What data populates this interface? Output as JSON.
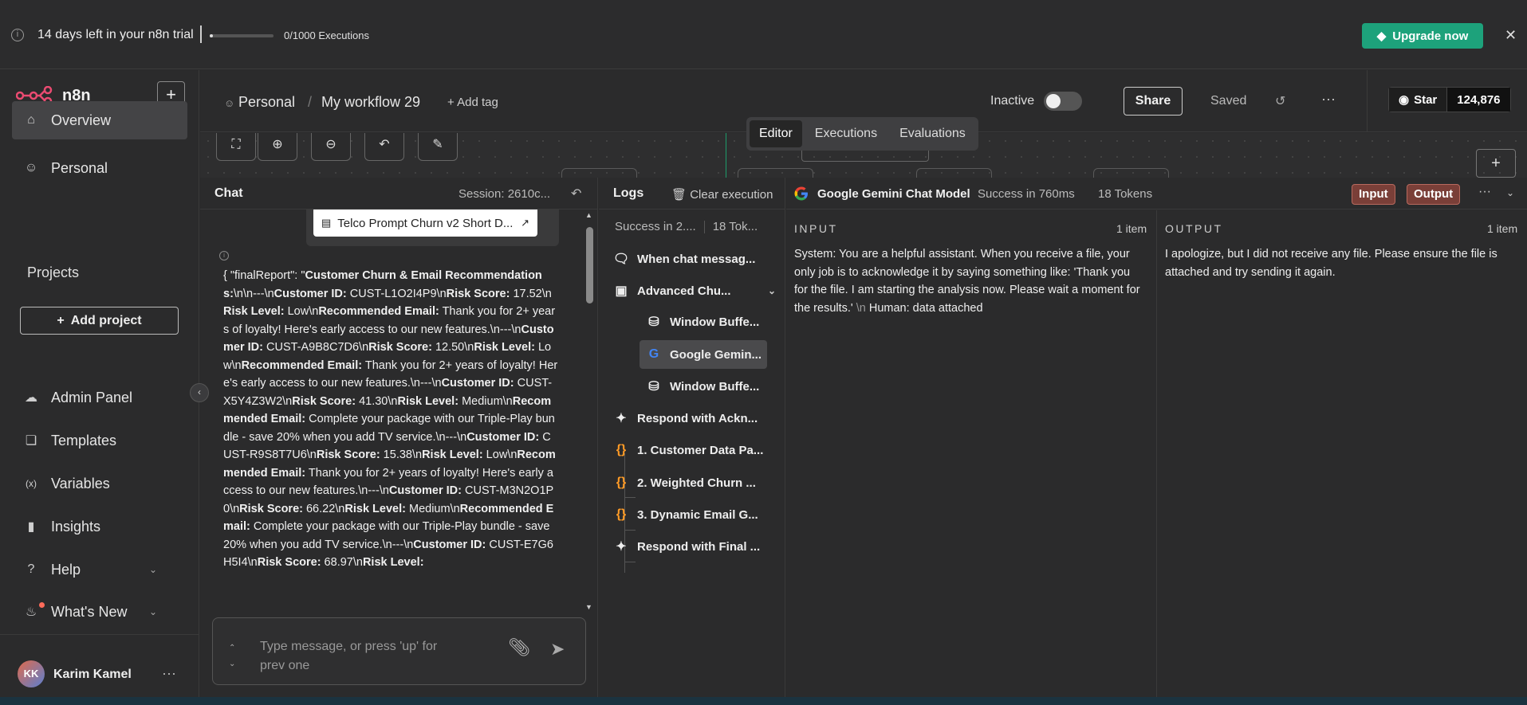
{
  "banner": {
    "trial_text": "14 days left in your n8n trial",
    "executions": "0/1000 Executions",
    "executions_used_fraction": 0.0,
    "upgrade_label": "Upgrade now",
    "upgrade_color": "#1da27b"
  },
  "sidebar": {
    "brand": "n8n",
    "items": [
      {
        "label": "Overview",
        "icon": "home-icon"
      },
      {
        "label": "Personal",
        "icon": "user-icon"
      }
    ],
    "projects_title": "Projects",
    "add_project": "Add project",
    "bottom_items": [
      {
        "label": "Admin Panel",
        "icon": "cloud-icon"
      },
      {
        "label": "Templates",
        "icon": "box-icon"
      },
      {
        "label": "Variables",
        "icon": "variable-icon"
      },
      {
        "label": "Insights",
        "icon": "chart-icon"
      },
      {
        "label": "Help",
        "icon": "help-icon"
      },
      {
        "label": "What's New",
        "icon": "bell-icon"
      }
    ],
    "user": {
      "initials": "KK",
      "name": "Karim Kamel"
    }
  },
  "header": {
    "project": "Personal",
    "workflow": "My workflow 29",
    "add_tag": "+ Add tag",
    "status": "Inactive",
    "share": "Share",
    "saved": "Saved",
    "github_star": "Star",
    "github_count": "124,876"
  },
  "canvas": {
    "tabs": [
      "Editor",
      "Executions",
      "Evaluations"
    ],
    "active_tab": "Editor"
  },
  "chat": {
    "title": "Chat",
    "session": "Session: 2610c...",
    "file_name": "Telco Prompt Churn v2 Short D...",
    "input_placeholder": "Type message, or press 'up' for prev one"
  },
  "logs": {
    "title": "Logs",
    "clear": "Clear execution",
    "summary_status": "Success in 2....",
    "summary_tokens": "18 Tok...",
    "items": [
      {
        "label": "When chat messag...",
        "icon": "chat-icon",
        "level": 0
      },
      {
        "label": "Advanced Chu...",
        "icon": "robot-icon",
        "level": 0
      },
      {
        "label": "Window Buffe...",
        "icon": "database-icon",
        "level": 1
      },
      {
        "label": "Google Gemin...",
        "icon": "google-icon",
        "level": 1
      },
      {
        "label": "Window Buffe...",
        "icon": "database-icon",
        "level": 1
      },
      {
        "label": "Respond with Ackn...",
        "icon": "webhook-icon",
        "level": 0
      },
      {
        "label": "1. Customer Data Pa...",
        "icon": "code-braces-icon",
        "level": 0
      },
      {
        "label": "2. Weighted Churn ...",
        "icon": "code-braces-icon",
        "level": 0
      },
      {
        "label": "3. Dynamic Email G...",
        "icon": "code-braces-icon",
        "level": 0
      },
      {
        "label": "Respond with Final ...",
        "icon": "webhook-icon",
        "level": 0
      }
    ]
  },
  "detail": {
    "node_title": "Google Gemini Chat Model",
    "status": "Success in 760ms",
    "tokens": "18 Tokens",
    "input_btn": "Input",
    "output_btn": "Output",
    "input_label": "INPUT",
    "input_count": "1 item",
    "input_text_1": "System: You are a helpful assistant. When you receive a file, your only job is to acknowledge it by saying something like: 'Thank you for the file. I am starting the analysis now. Please wait a moment for the results.'",
    "input_text_nl": "\\n",
    "input_text_2": "Human: data attached",
    "output_label": "OUTPUT",
    "output_count": "1 item",
    "output_text": "I apologize, but I did not receive any file. Please ensure the file is attached and try sending it again."
  }
}
